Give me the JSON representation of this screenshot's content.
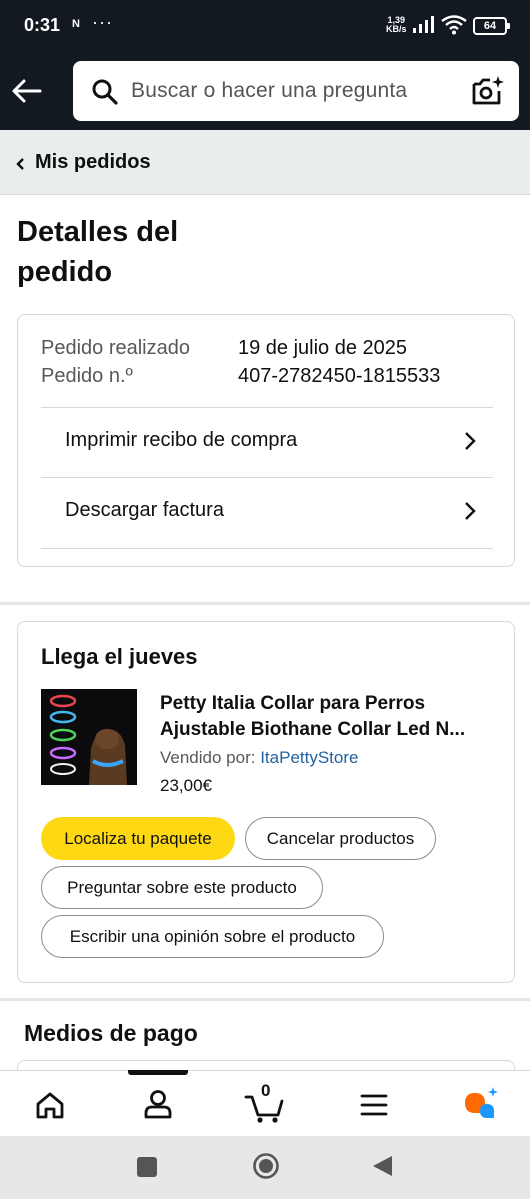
{
  "status_bar": {
    "time": "0:31",
    "notification": "N",
    "dots": "···",
    "speed_top": "1,39",
    "speed_bottom": "KB/s",
    "battery": "64"
  },
  "search": {
    "placeholder": "Buscar o hacer una pregunta"
  },
  "breadcrumb": {
    "label": "Mis pedidos"
  },
  "page": {
    "title": "Detalles del pedido"
  },
  "order_info": {
    "placed_label": "Pedido realizado",
    "placed_value": "19 de julio de 2025",
    "number_label": "Pedido n.º",
    "number_value": "407-2782450-1815533",
    "links": [
      {
        "label": "Imprimir recibo de compra"
      },
      {
        "label": "Descargar factura"
      }
    ]
  },
  "delivery": {
    "title": "Llega el jueves",
    "product": {
      "title_line1": "Petty Italia Collar para Perros",
      "title_line2": "Ajustable Biothane Collar Led N...",
      "sold_by_label": "Vendido por:",
      "seller": "ItaPettyStore",
      "price": "23,00€"
    },
    "buttons": {
      "track": "Localiza tu paquete",
      "cancel": "Cancelar productos",
      "ask": "Preguntar sobre este producto",
      "review": "Escribir una opinión sobre el producto"
    }
  },
  "payment": {
    "title": "Medios de pago"
  },
  "bottom_nav": {
    "items": [
      "home-icon",
      "account-icon",
      "cart-icon",
      "menu-icon",
      "rufus-icon"
    ],
    "cart_count": "0",
    "active": "account-icon"
  },
  "colors": {
    "header_bg": "#131921",
    "primary_button": "#ffd814",
    "link": "#2162a1",
    "rufus_orange": "#ff6a00",
    "rufus_blue": "#1a98ff"
  }
}
